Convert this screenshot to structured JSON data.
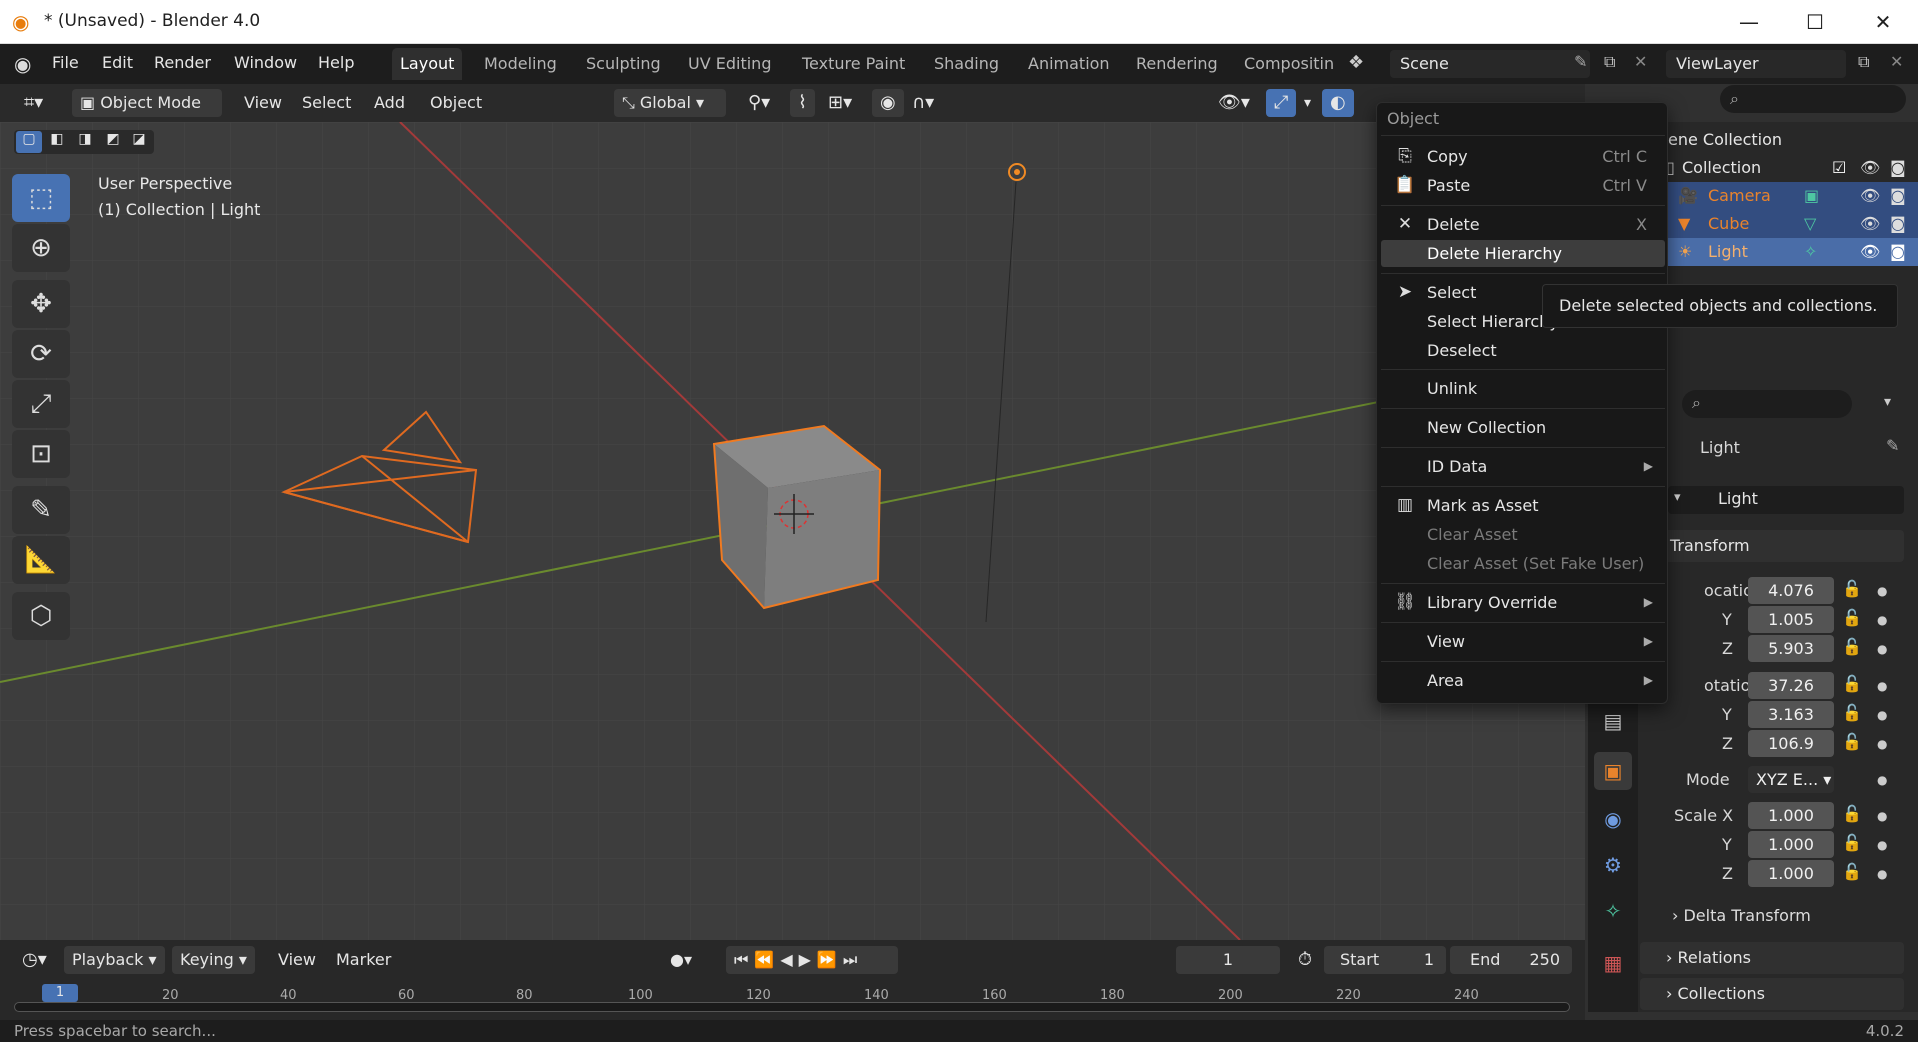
{
  "window": {
    "title": "* (Unsaved) - Blender 4.0",
    "min_glyph": "—",
    "max_glyph": "☐",
    "close_glyph": "✕"
  },
  "topbar": {
    "menus": [
      "File",
      "Edit",
      "Render",
      "Window",
      "Help"
    ],
    "workspaces": [
      "Layout",
      "Modeling",
      "Sculpting",
      "UV Editing",
      "Texture Paint",
      "Shading",
      "Animation",
      "Rendering",
      "Compositin"
    ],
    "active_workspace": "Layout",
    "scene": "Scene",
    "view_layer": "ViewLayer"
  },
  "header3d": {
    "mode": "Object Mode",
    "menus": [
      "View",
      "Select",
      "Add",
      "Object"
    ],
    "orientation": "Global"
  },
  "viewport": {
    "perspective": "User Perspective",
    "context": "(1) Collection | Light"
  },
  "context_menu": {
    "title": "Object",
    "items": [
      {
        "label": "Copy",
        "shortcut": "Ctrl C",
        "icon": "copy-icon"
      },
      {
        "label": "Paste",
        "shortcut": "Ctrl V",
        "icon": "paste-icon"
      },
      {
        "label": "Delete",
        "shortcut": "X",
        "icon": "x-icon"
      },
      {
        "label": "Delete Hierarchy",
        "shortcut": "",
        "icon": ""
      },
      {
        "label": "Select",
        "shortcut": "",
        "icon": "cursor-icon"
      },
      {
        "label": "Select Hierarchy",
        "shortcut": "",
        "icon": ""
      },
      {
        "label": "Deselect",
        "shortcut": "",
        "icon": ""
      },
      {
        "label": "Unlink",
        "shortcut": "",
        "icon": ""
      },
      {
        "label": "New Collection",
        "shortcut": "",
        "icon": ""
      },
      {
        "label": "ID Data",
        "shortcut": "",
        "icon": ""
      },
      {
        "label": "Mark as Asset",
        "shortcut": "",
        "icon": "asset-icon"
      },
      {
        "label": "Clear Asset",
        "shortcut": "",
        "icon": ""
      },
      {
        "label": "Clear Asset (Set Fake User)",
        "shortcut": "",
        "icon": ""
      },
      {
        "label": "Library Override",
        "shortcut": "",
        "icon": "override-icon"
      },
      {
        "label": "View",
        "shortcut": "",
        "icon": ""
      },
      {
        "label": "Area",
        "shortcut": "",
        "icon": ""
      }
    ],
    "highlighted": "Delete Hierarchy",
    "tooltip": "Delete selected objects and collections."
  },
  "outliner": {
    "root": "ene Collection",
    "collection": "Collection",
    "objects": [
      "Camera",
      "Cube",
      "Light"
    ]
  },
  "properties": {
    "object_name": "Light",
    "data_name": "Light",
    "panel": "Transform",
    "location_label": "ocatio...",
    "location": [
      "4.076",
      "1.005",
      "5.903"
    ],
    "rotation_label": "otatio...",
    "rotation": [
      "37.26",
      "3.163",
      "106.9"
    ],
    "axis_y": "Y",
    "axis_z": "Z",
    "mode_label": "Mode",
    "mode_value": "XYZ E...",
    "scale_label": "Scale X",
    "scale": [
      "1.000",
      "1.000",
      "1.000"
    ],
    "subpanels": [
      "Delta Transform",
      "Relations",
      "Collections"
    ]
  },
  "timeline": {
    "menus": [
      "Playback",
      "Keying",
      "View",
      "Marker"
    ],
    "current_frame": "1",
    "start_label": "Start",
    "start": "1",
    "end_label": "End",
    "end": "250",
    "ticks": [
      "1",
      "20",
      "40",
      "60",
      "80",
      "100",
      "120",
      "140",
      "160",
      "180",
      "200",
      "220",
      "240"
    ]
  },
  "statusbar": {
    "hint": "Press spacebar to search...",
    "version": "4.0.2"
  }
}
